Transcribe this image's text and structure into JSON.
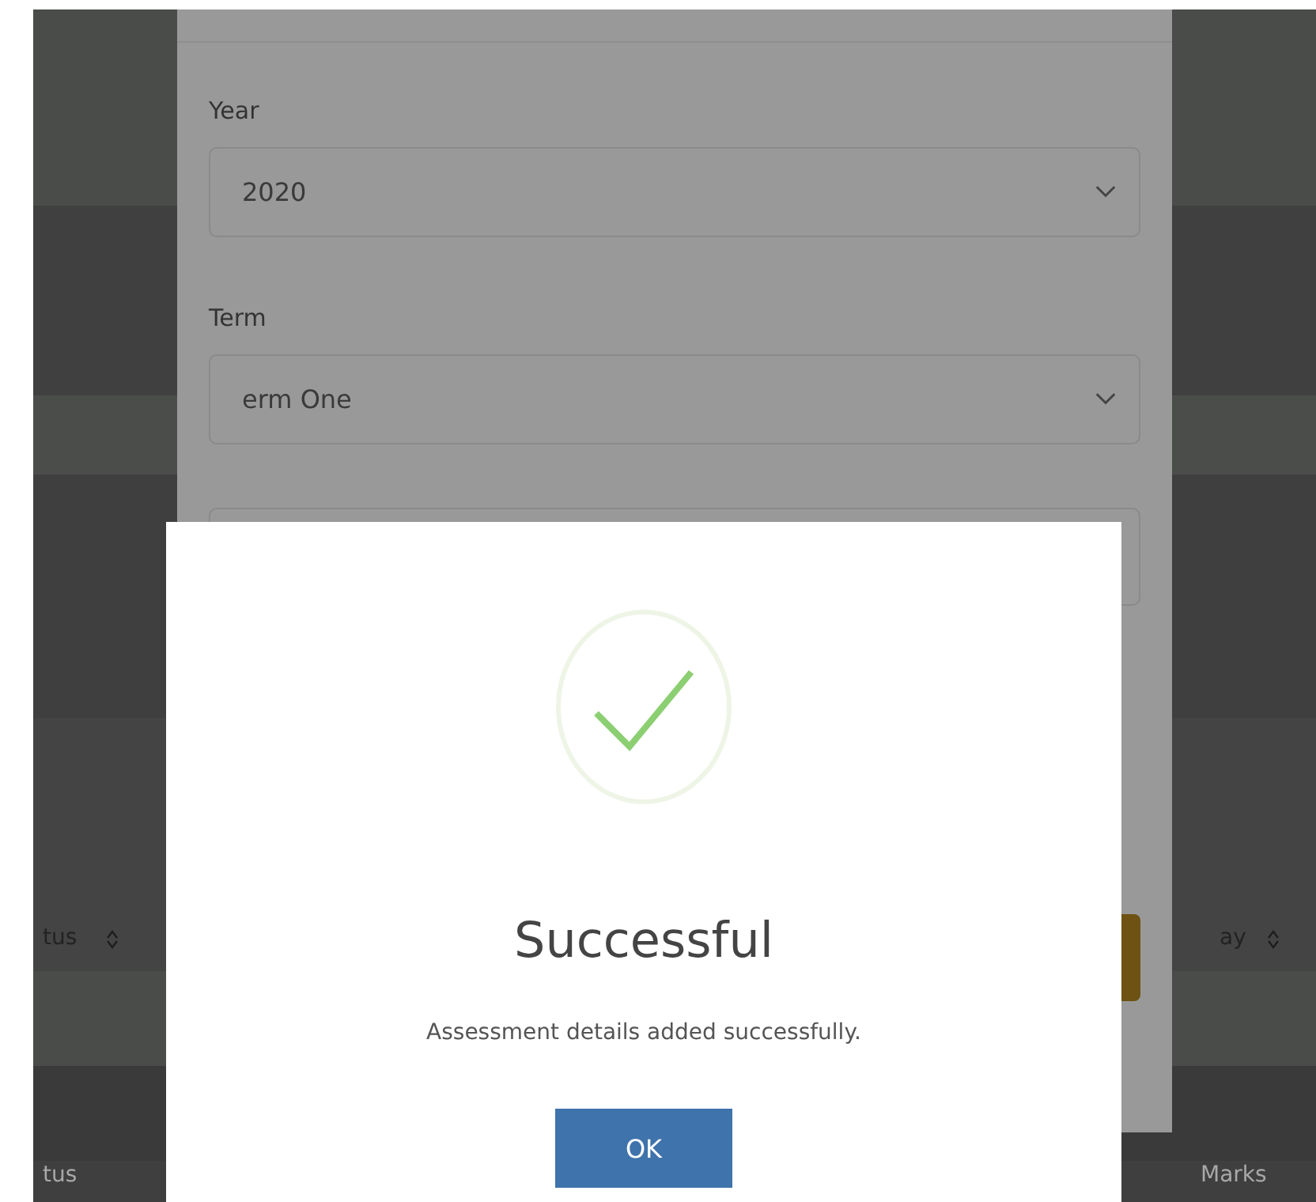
{
  "background_table": {
    "header_left": "tus",
    "header_right": "ay",
    "row_left": "tus",
    "row_right": "Marks"
  },
  "form_modal": {
    "fields": [
      {
        "label": "Year",
        "value": "2020"
      },
      {
        "label": "Term",
        "value": "erm One"
      }
    ]
  },
  "success_dialog": {
    "title": "Successful",
    "message": "Assessment details added successfully.",
    "button": "OK"
  }
}
